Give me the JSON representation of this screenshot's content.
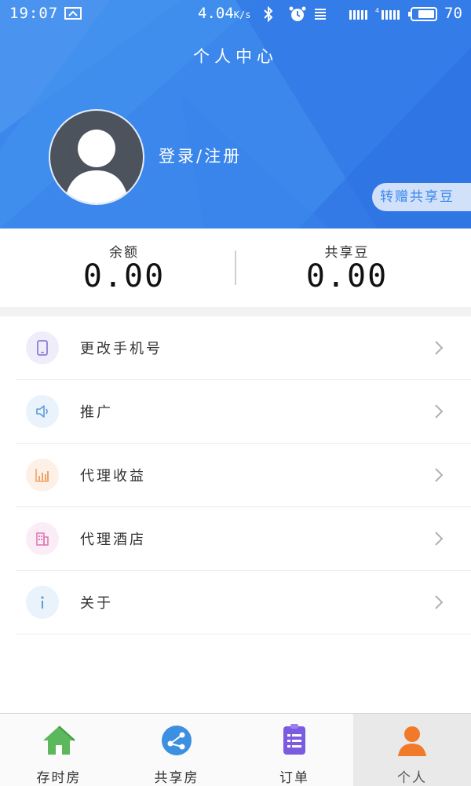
{
  "status_bar": {
    "time": "19:07",
    "net_speed": "4.04",
    "net_speed_unit": "K/s",
    "battery": "70"
  },
  "header": {
    "title": "个人中心",
    "login_label": "登录/注册",
    "gift_label": "转赠共享豆"
  },
  "balances": {
    "balance_label": "余额",
    "balance_value": "0.00",
    "beans_label": "共享豆",
    "beans_value": "0.00"
  },
  "menu": {
    "items": [
      {
        "label": "更改手机号",
        "icon": "phone-icon",
        "color": "#8a7fd6",
        "bg": "#efedfa"
      },
      {
        "label": "推广",
        "icon": "speaker-icon",
        "color": "#5b9bd8",
        "bg": "#eaf2fb"
      },
      {
        "label": "代理收益",
        "icon": "bar-chart-icon",
        "color": "#f0a46c",
        "bg": "#fdf1e7"
      },
      {
        "label": "代理酒店",
        "icon": "building-icon",
        "color": "#e07ab8",
        "bg": "#fbedf6"
      },
      {
        "label": "关于",
        "icon": "info-icon",
        "color": "#5b9bd8",
        "bg": "#eaf2fb"
      }
    ]
  },
  "tabs": [
    {
      "label": "存时房",
      "icon": "house-icon",
      "color": "#5cb85c"
    },
    {
      "label": "共享房",
      "icon": "share-globe-icon",
      "color": "#3d8fe0"
    },
    {
      "label": "订单",
      "icon": "order-list-icon",
      "color": "#7b5be0"
    },
    {
      "label": "个人",
      "icon": "person-icon",
      "color": "#f07a2a",
      "active": true
    }
  ]
}
